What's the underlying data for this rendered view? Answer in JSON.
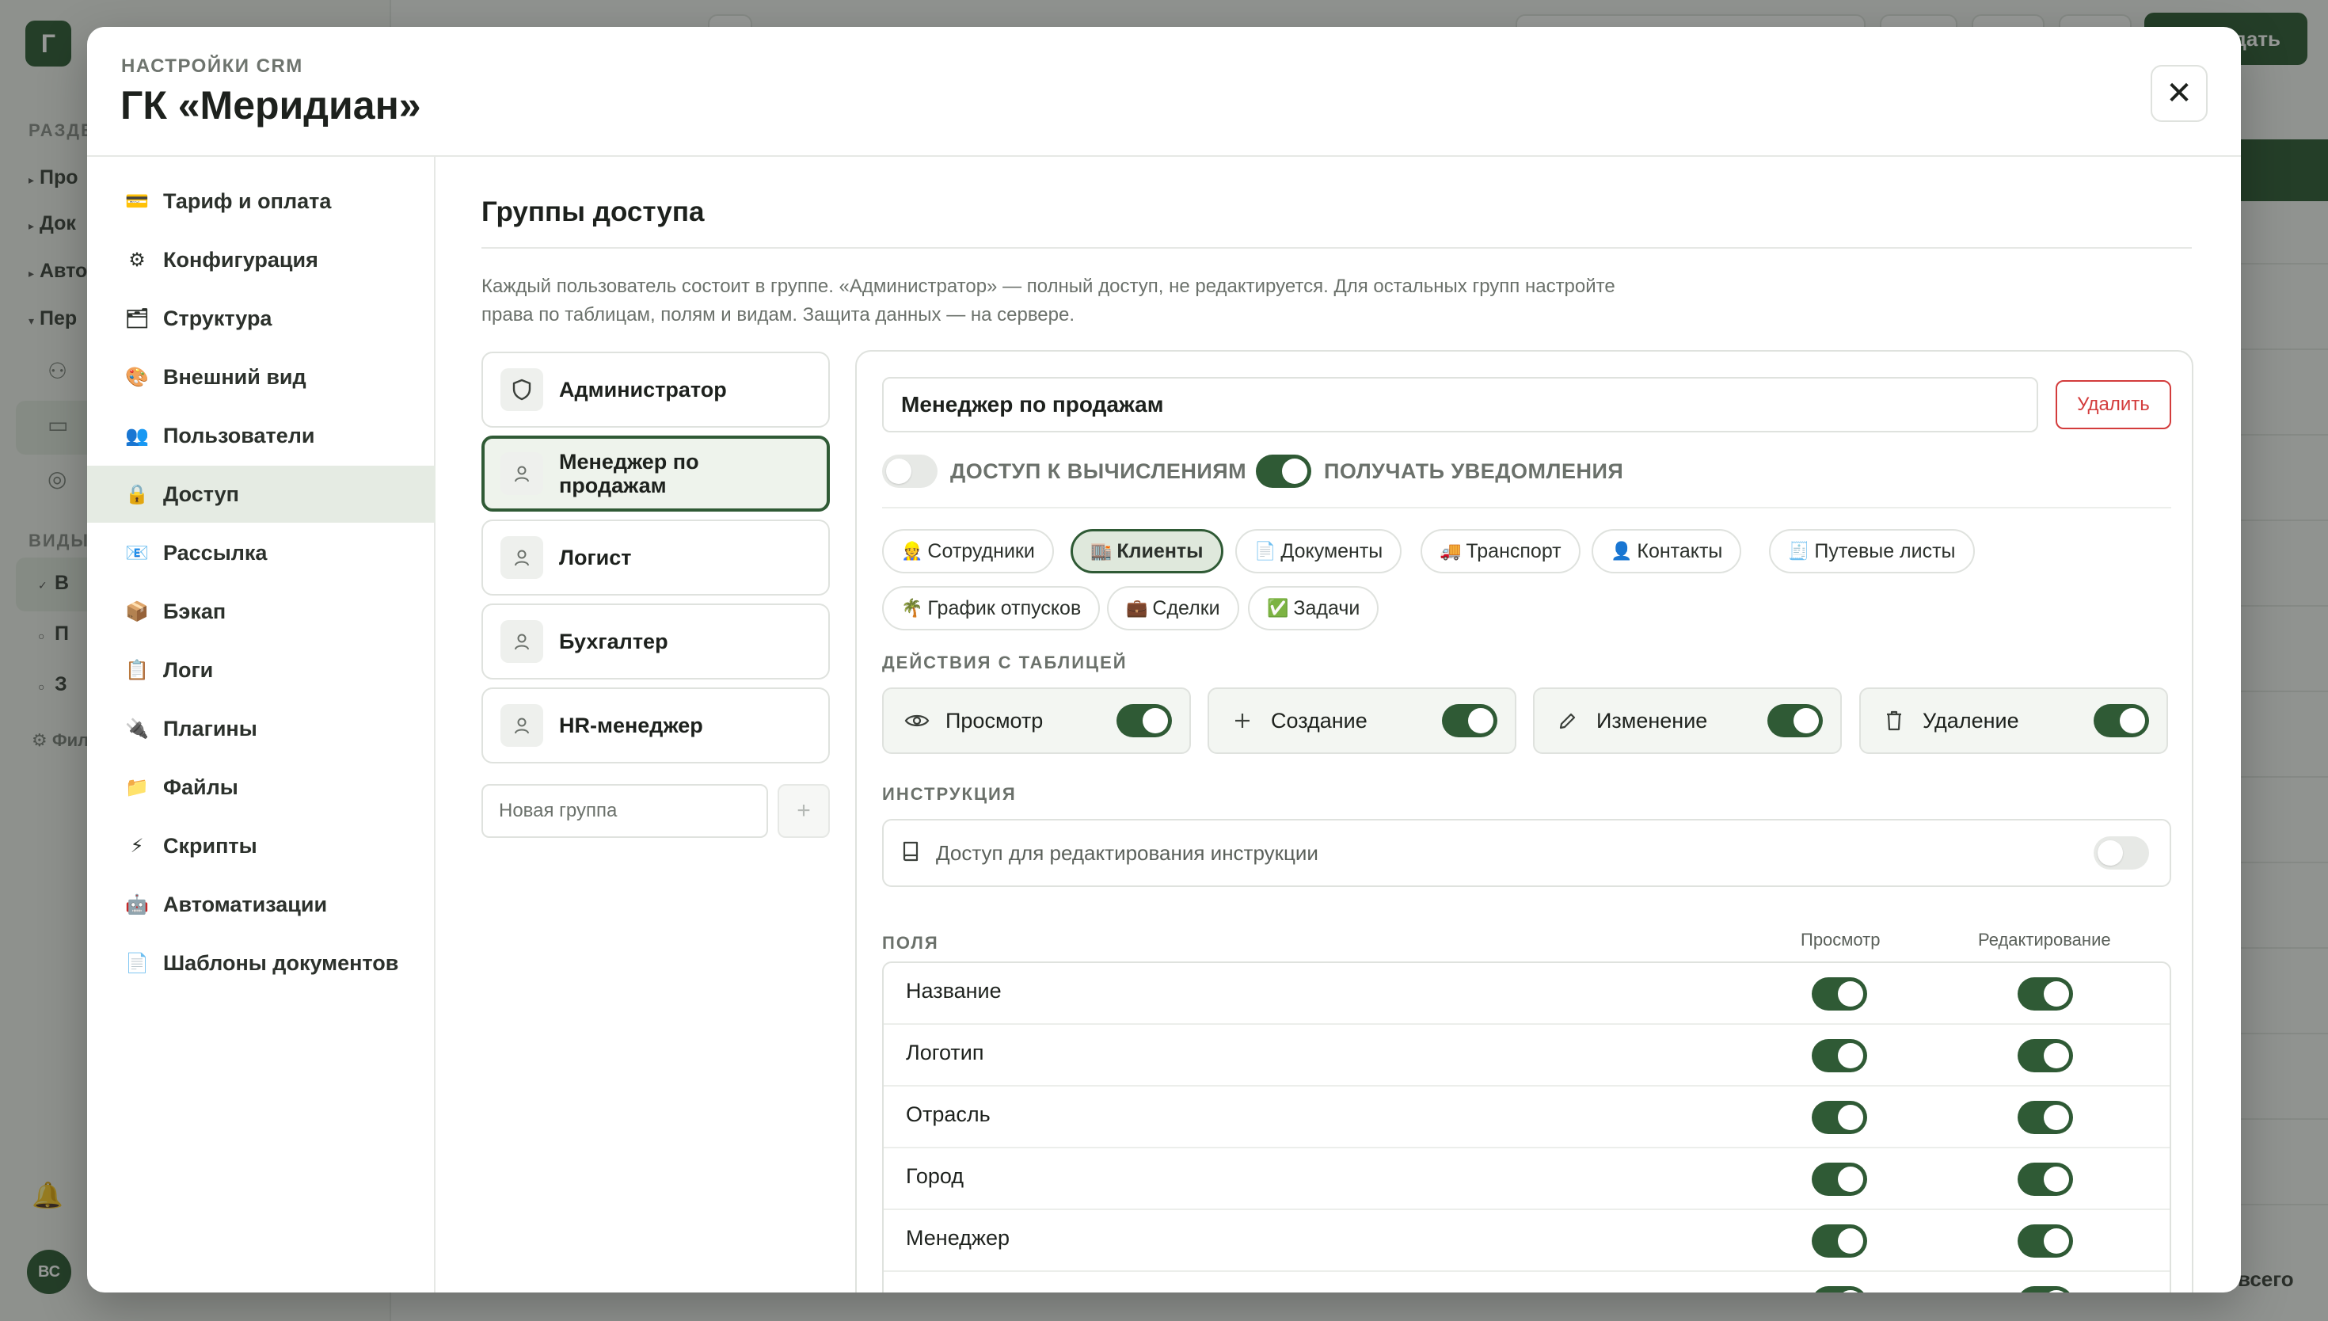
{
  "background": {
    "logo": "Г",
    "rail_heading": "РАЗДЕ",
    "rail_items": [
      "Про",
      "Док",
      "Авто",
      "Пер"
    ],
    "views_heading": "ВИДЫ",
    "view_items": [
      "В",
      "П",
      "З"
    ],
    "filter_label": "Фил",
    "avatar": "ВС",
    "create_label": "дать",
    "total_label": "всего"
  },
  "modal": {
    "eyebrow": "НАСТРОЙКИ CRM",
    "title": "ГК «Меридиан»",
    "close_label": "✕"
  },
  "sidebar": {
    "items": [
      {
        "icon": "💳",
        "label": "Тариф и оплата"
      },
      {
        "icon": "⚙",
        "label": "Конфигурация"
      },
      {
        "icon": "🗂",
        "label": "Структура"
      },
      {
        "icon": "🎨",
        "label": "Внешний вид"
      },
      {
        "icon": "👥",
        "label": "Пользователи"
      },
      {
        "icon": "🔒",
        "label": "Доступ"
      },
      {
        "icon": "📧",
        "label": "Рассылка"
      },
      {
        "icon": "📦",
        "label": "Бэкап"
      },
      {
        "icon": "📋",
        "label": "Логи"
      },
      {
        "icon": "🔌",
        "label": "Плагины"
      },
      {
        "icon": "📁",
        "label": "Файлы"
      },
      {
        "icon": "⚡",
        "label": "Скрипты"
      },
      {
        "icon": "🤖",
        "label": "Автоматизации"
      },
      {
        "icon": "📄",
        "label": "Шаблоны документов"
      }
    ],
    "active_index": 5
  },
  "access": {
    "title": "Группы доступа",
    "description": "Каждый пользователь состоит в группе. «Администратор» — полный доступ, не редактируется. Для остальных групп настройте права по таблицам, полям и видам. Защита данных — на сервере.",
    "groups": [
      {
        "icon": "shield-icon",
        "label": "Администратор"
      },
      {
        "icon": "user-icon",
        "label": "Менеджер по продажам"
      },
      {
        "icon": "user-icon",
        "label": "Логист"
      },
      {
        "icon": "user-icon",
        "label": "Бухгалтер"
      },
      {
        "icon": "user-icon",
        "label": "HR-менеджер"
      }
    ],
    "active_group": 1,
    "new_group_placeholder": "Новая группа",
    "add_group_label": "+"
  },
  "editor": {
    "group_name": "Менеджер по продажам",
    "delete_label": "Удалить",
    "flags": [
      {
        "label": "ДОСТУП К ВЫЧИСЛЕНИЯМ",
        "on": false
      },
      {
        "label": "ПОЛУЧАТЬ УВЕДОМЛЕНИЯ",
        "on": true
      }
    ],
    "tables": [
      {
        "icon": "👷",
        "label": "Сотрудники"
      },
      {
        "icon": "🏬",
        "label": "Клиенты"
      },
      {
        "icon": "📄",
        "label": "Документы"
      },
      {
        "icon": "🚚",
        "label": "Транспорт"
      },
      {
        "icon": "👤",
        "label": "Контакты"
      },
      {
        "icon": "🧾",
        "label": "Путевые листы"
      },
      {
        "icon": "🌴",
        "label": "График отпусков"
      },
      {
        "icon": "💼",
        "label": "Сделки"
      },
      {
        "icon": "✅",
        "label": "Задачи"
      }
    ],
    "active_table": 1,
    "table_actions_label": "ДЕЙСТВИЯ С ТАБЛИЦЕЙ",
    "actions": [
      {
        "icon": "eye-icon",
        "glyph": "👁",
        "label": "Просмотр",
        "on": true
      },
      {
        "icon": "plus-icon",
        "glyph": "+",
        "label": "Создание",
        "on": true
      },
      {
        "icon": "pencil-icon",
        "glyph": "✎",
        "label": "Изменение",
        "on": true
      },
      {
        "icon": "trash-icon",
        "glyph": "🗑",
        "label": "Удаление",
        "on": true
      }
    ],
    "instruction_label": "ИНСТРУКЦИЯ",
    "instruction_text": "Доступ для редактирования инструкции",
    "instruction_on": false,
    "fields_label": "ПОЛЯ",
    "view_col": "Просмотр",
    "edit_col": "Редактирование",
    "fields": [
      {
        "name": "Название",
        "view": true,
        "edit": true
      },
      {
        "name": "Логотип",
        "view": true,
        "edit": true
      },
      {
        "name": "Отрасль",
        "view": true,
        "edit": true
      },
      {
        "name": "Город",
        "view": true,
        "edit": true
      },
      {
        "name": "Менеджер",
        "view": true,
        "edit": true
      }
    ]
  },
  "colors": {
    "accent": "#2f5a35",
    "accent_soft": "#e5ebe3",
    "danger": "#d33c3c",
    "border": "#dfe2de"
  }
}
